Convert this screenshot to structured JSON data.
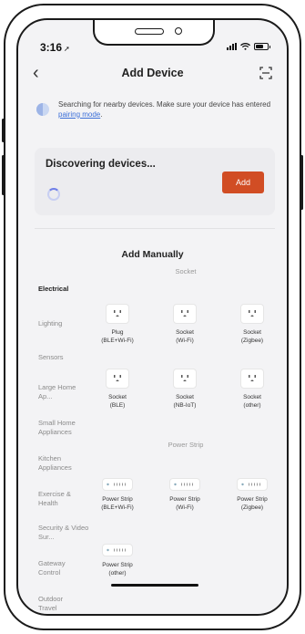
{
  "status_bar": {
    "time": "3:16",
    "time_arrow": "➚"
  },
  "nav": {
    "back": "‹",
    "title": "Add Device"
  },
  "notice": {
    "text": "Searching for nearby devices. Make sure your device has entered ",
    "link": "pairing mode",
    "suffix": "."
  },
  "discover": {
    "title": "Discovering devices...",
    "add_label": "Add"
  },
  "section": {
    "title": "Add Manually"
  },
  "categories": [
    {
      "label": "Electrical",
      "active": true
    },
    {
      "label": "Lighting"
    },
    {
      "label": "Sensors"
    },
    {
      "label": "Large Home Ap..."
    },
    {
      "label": "Small Home Appliances"
    },
    {
      "label": "Kitchen Appliances"
    },
    {
      "label": "Exercise & Health"
    },
    {
      "label": "Security & Video Sur..."
    },
    {
      "label": "Gateway Control"
    },
    {
      "label": "Outdoor Travel"
    }
  ],
  "groups": {
    "socket": "Socket",
    "power_strip": "Power Strip"
  },
  "products": {
    "socket": [
      {
        "name": "Plug",
        "sub": "(BLE+Wi-Fi)"
      },
      {
        "name": "Socket",
        "sub": "(Wi-Fi)"
      },
      {
        "name": "Socket",
        "sub": "(Zigbee)"
      },
      {
        "name": "Socket",
        "sub": "(BLE)"
      },
      {
        "name": "Socket",
        "sub": "(NB-IoT)"
      },
      {
        "name": "Socket",
        "sub": "(other)"
      }
    ],
    "strip": [
      {
        "name": "Power Strip",
        "sub": "(BLE+Wi-Fi)"
      },
      {
        "name": "Power Strip",
        "sub": "(Wi-Fi)"
      },
      {
        "name": "Power Strip",
        "sub": "(Zigbee)"
      },
      {
        "name": "Power Strip",
        "sub": "(other)"
      }
    ]
  },
  "colors": {
    "accent": "#d14d24",
    "link": "#3b6fd8",
    "background": "#f3f3f5"
  }
}
